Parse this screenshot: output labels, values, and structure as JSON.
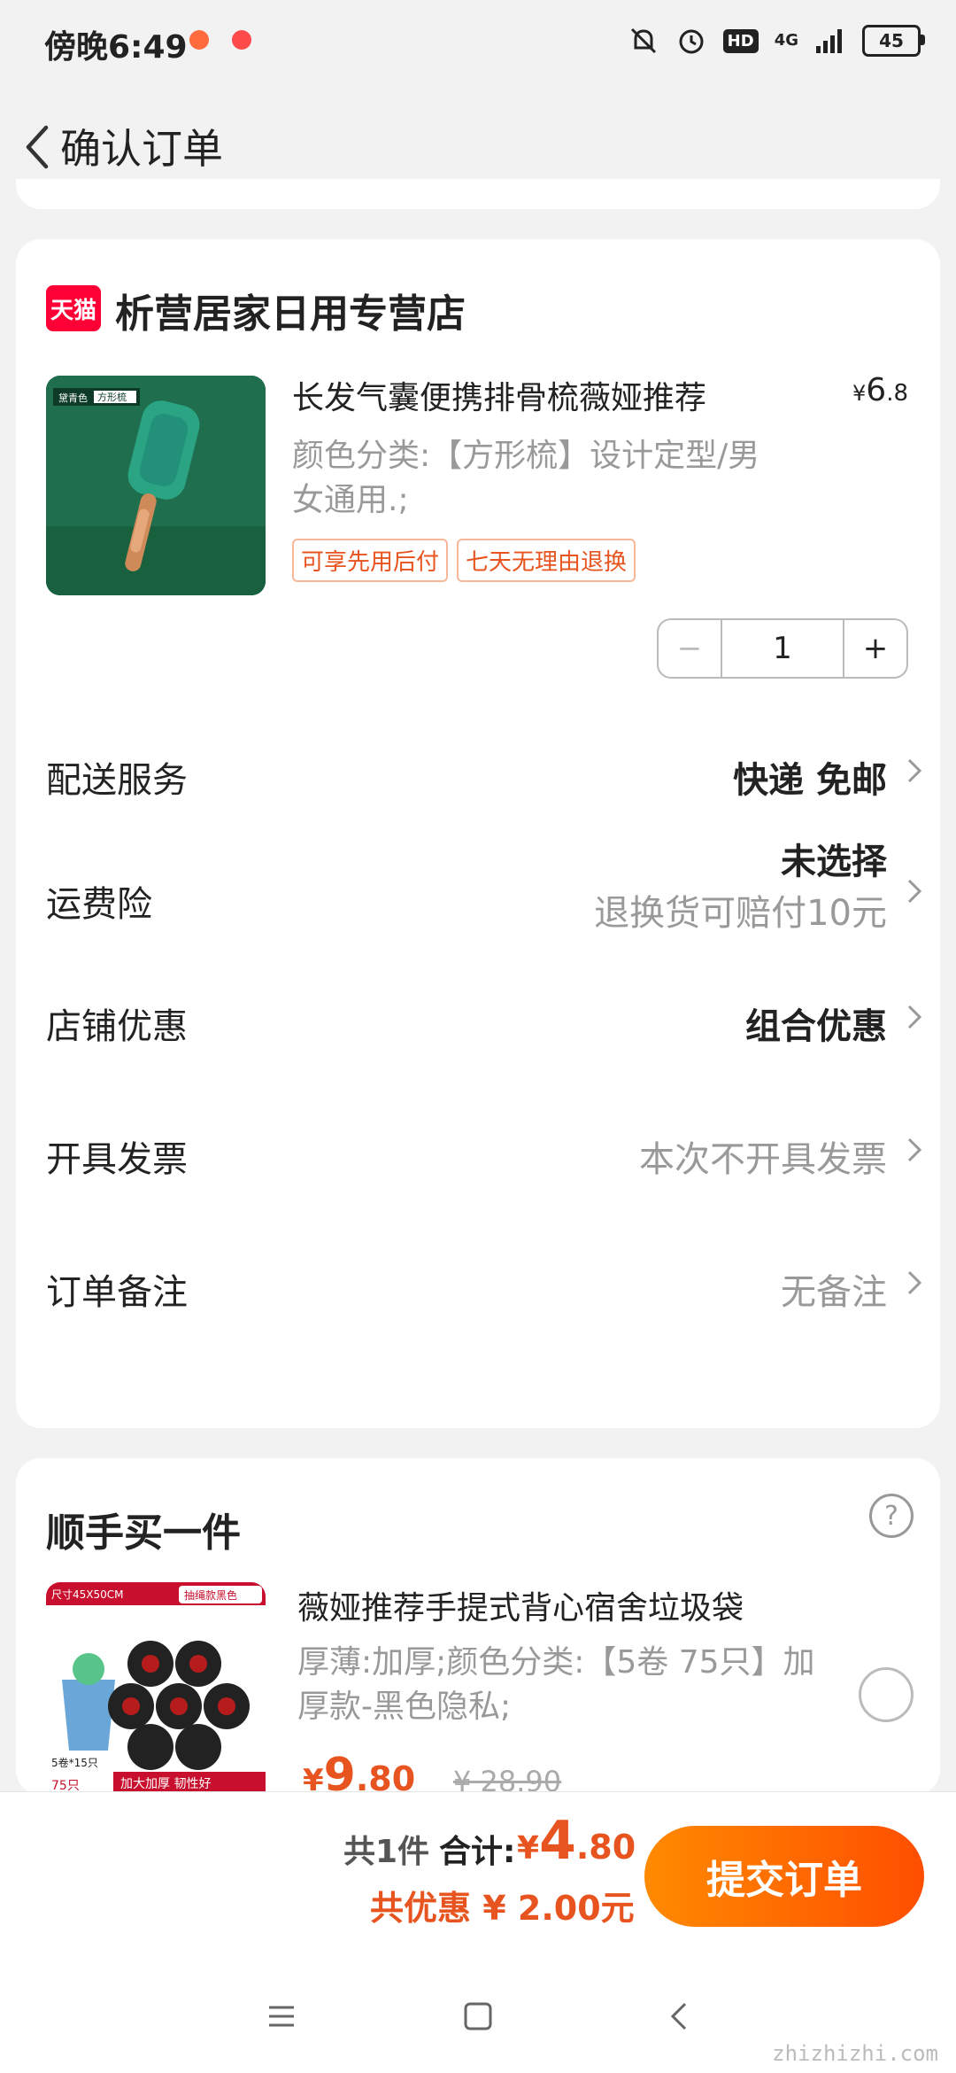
{
  "status_bar": {
    "time": "傍晚6:49",
    "hd": "HD",
    "network": "4G",
    "battery": "45"
  },
  "header": {
    "title": "确认订单"
  },
  "store": {
    "logo_text": "天猫",
    "name": "析营居家日用专营店",
    "product": {
      "title": "长发气囊便携排骨梳薇娅推荐",
      "price_currency": "¥",
      "price_int": "6",
      "price_dec": ".8",
      "spec": "颜色分类:【方形梳】设计定型/男女通用.;",
      "tags": [
        "可享先用后付",
        "七天无理由退换"
      ],
      "image_labels": [
        "黛青色",
        "方形梳"
      ],
      "quantity": "1"
    },
    "rows": [
      {
        "label": "配送服务",
        "value": "快递 免邮",
        "sub": ""
      },
      {
        "label": "运费险",
        "value": "未选择",
        "sub": "退换货可赔付10元"
      },
      {
        "label": "店铺优惠",
        "value": "组合优惠",
        "sub": ""
      },
      {
        "label": "开具发票",
        "value": "本次不开具发票",
        "sub": ""
      },
      {
        "label": "订单备注",
        "value": "无备注",
        "sub": ""
      }
    ]
  },
  "addon": {
    "title": "顺手买一件",
    "help": "?",
    "image_labels": {
      "size": "尺寸45X50CM",
      "type": "抽绳款黑色",
      "count": "5卷*15只",
      "small": "75只",
      "banner": "加大加厚 韧性好"
    },
    "name": "薇娅推荐手提式背心宿舍垃圾袋",
    "spec": "厚薄:加厚;颜色分类:【5卷 75只】加厚款-黑色隐私;",
    "price_currency": "¥",
    "price_int": "9",
    "price_dec": ".80",
    "original_price": "¥ 28.90"
  },
  "bottom": {
    "count": "共1件",
    "total_label": "合计:",
    "total_currency": "¥",
    "total_int": "4",
    "total_dec": ".80",
    "discount": "共优惠 ¥ 2.00元",
    "submit": "提交订单"
  },
  "watermark": "zhizhizhi.com",
  "colors": {
    "accent": "#e8541f",
    "tmall": "#ff0036",
    "button_start": "#ff8a00",
    "button_end": "#ff4e00"
  }
}
